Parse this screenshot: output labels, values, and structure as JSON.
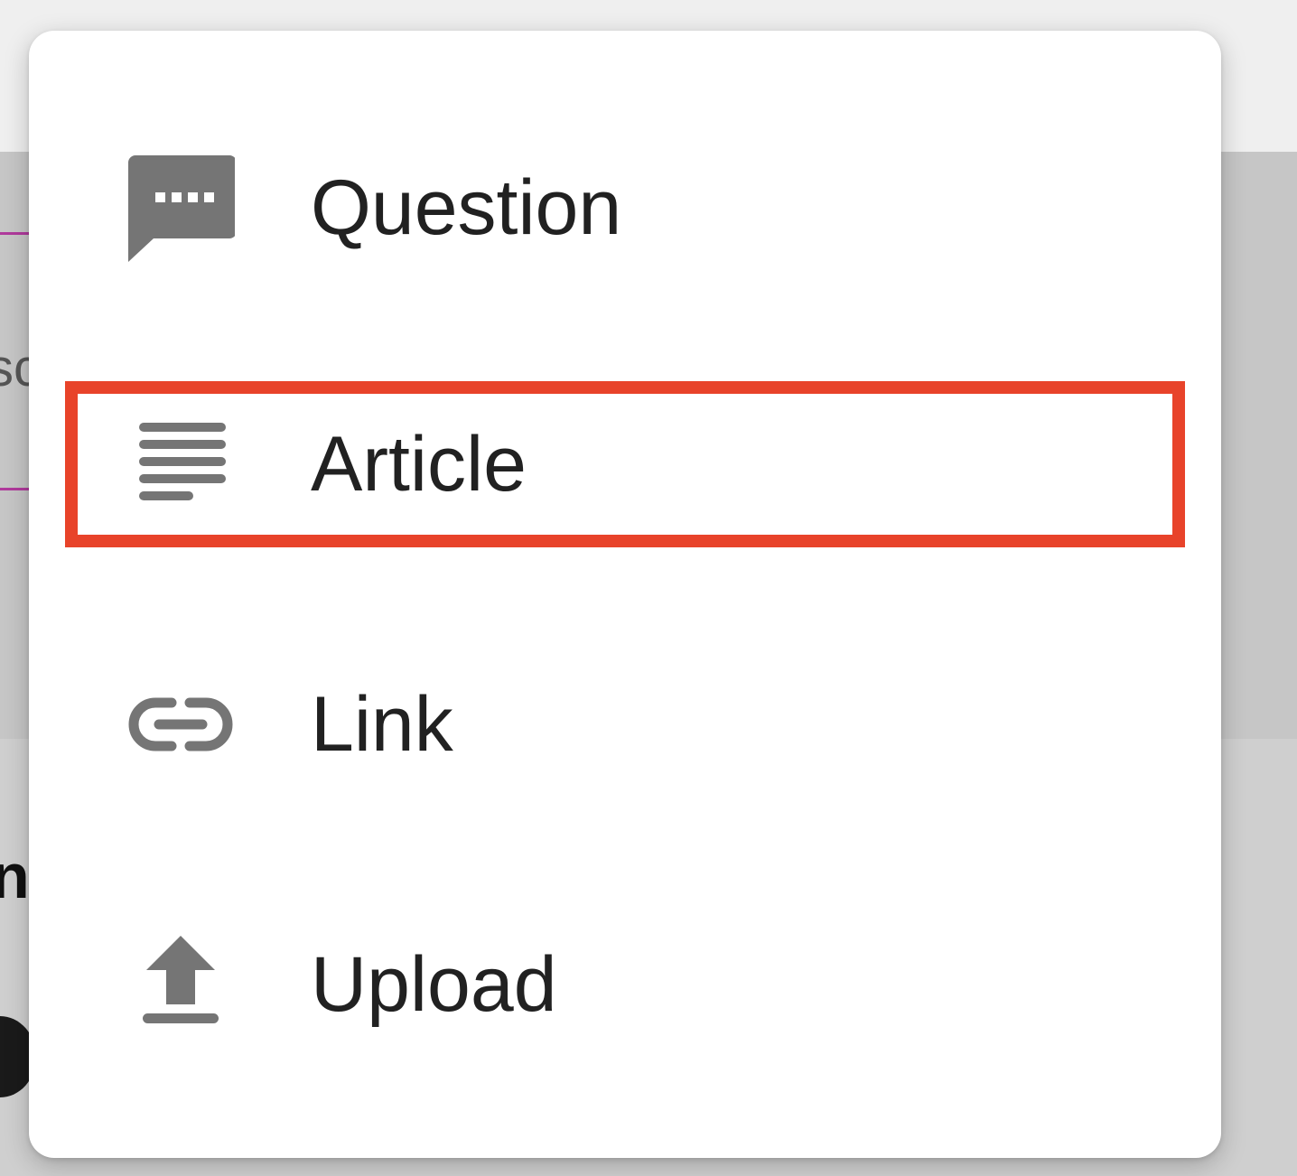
{
  "menu": {
    "items": [
      {
        "label": "Question",
        "icon": "chat-bubble-icon",
        "highlighted": false
      },
      {
        "label": "Article",
        "icon": "article-lines-icon",
        "highlighted": true
      },
      {
        "label": "Link",
        "icon": "link-icon",
        "highlighted": false
      },
      {
        "label": "Upload",
        "icon": "upload-icon",
        "highlighted": false
      }
    ]
  },
  "background": {
    "partial_text": "sc",
    "partial_bold_text": "n"
  },
  "colors": {
    "highlight_border": "#e8432a",
    "icon": "#757575",
    "text": "#212121",
    "accent_line": "#b03a9c"
  }
}
